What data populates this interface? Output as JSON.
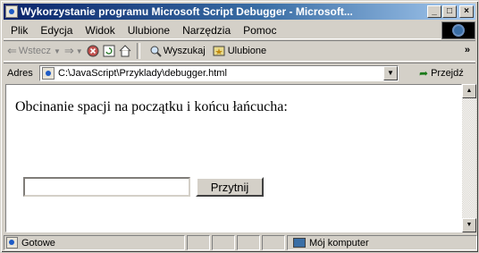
{
  "window": {
    "title": "Wykorzystanie programu Microsoft Script Debugger - Microsoft...",
    "controls": {
      "minimize": "_",
      "maximize": "□",
      "close": "×"
    }
  },
  "menu": {
    "items": [
      "Plik",
      "Edycja",
      "Widok",
      "Ulubione",
      "Narzędzia",
      "Pomoc"
    ]
  },
  "toolbar": {
    "back_label": "Wstecz",
    "search_label": "Wyszukaj",
    "favorites_label": "Ulubione",
    "more": "»",
    "icons": [
      "back-arrow-icon",
      "forward-arrow-icon",
      "stop-icon",
      "refresh-icon",
      "home-icon",
      "search-icon",
      "favorites-icon"
    ]
  },
  "address": {
    "label": "Adres",
    "url": "C:\\JavaScript\\Przyklady\\debugger.html",
    "go_label": "Przejdź"
  },
  "page": {
    "text": "Obcinanie spacji na początku i końcu łańcucha:",
    "input_value": "",
    "button_label": "Przytnij"
  },
  "status": {
    "text": "Gotowe",
    "zone": "Mój komputer"
  }
}
